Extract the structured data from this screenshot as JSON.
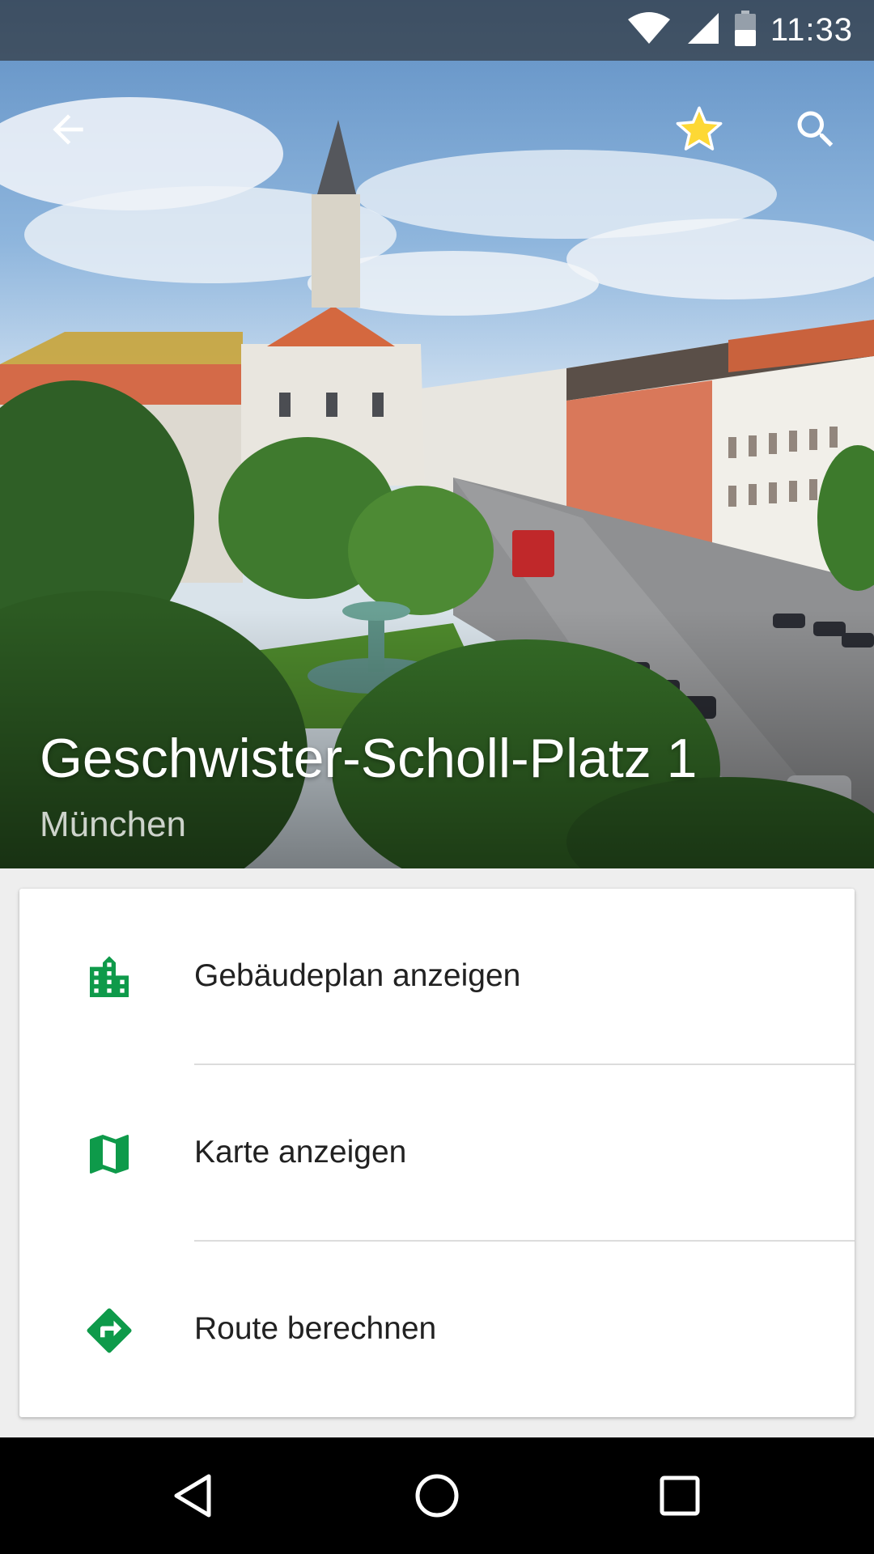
{
  "status_bar": {
    "time": "11:33",
    "icons": [
      "wifi-icon",
      "cell-signal-icon",
      "battery-icon"
    ]
  },
  "toolbar": {
    "back_icon": "arrow-back-icon",
    "favorite_icon": "star-icon",
    "search_icon": "search-icon",
    "colors": {
      "star": "#fdd835",
      "icon": "#ffffff"
    }
  },
  "header": {
    "title": "Geschwister-Scholl-Platz 1",
    "subtitle": "München"
  },
  "actions": [
    {
      "label": "Gebäudeplan anzeigen",
      "icon": "building-icon"
    },
    {
      "label": "Karte anzeigen",
      "icon": "map-icon"
    },
    {
      "label": "Route berechnen",
      "icon": "directions-icon"
    }
  ],
  "accent_color": "#0e9a4a",
  "navigation_bar": {
    "buttons": [
      "back-triangle-icon",
      "home-circle-icon",
      "recents-square-icon"
    ]
  }
}
